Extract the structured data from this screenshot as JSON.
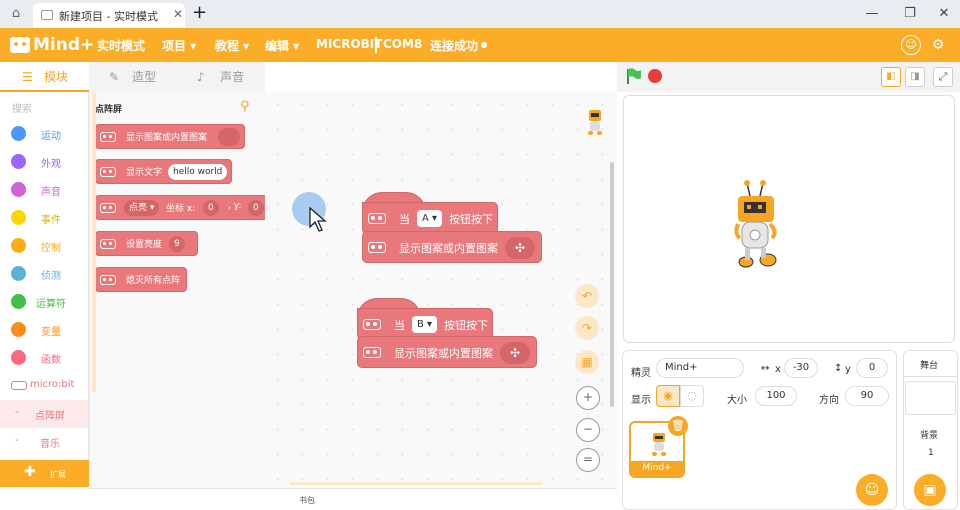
{
  "titlebar": {
    "tab_title": "新建项目 - 实时模式",
    "close": "✕",
    "new_tab": "+",
    "minimize": "—",
    "restore": "❐",
    "close_window": "✕"
  },
  "menubar": {
    "logo_text": "Mind+",
    "items": [
      "实时模式",
      "项目 ▾",
      "教程 ▾",
      "编辑 ▾",
      "MICROBIT",
      "COM8",
      "连接成功"
    ],
    "accent_color": "#fbad28"
  },
  "category_tabs": [
    "模块",
    "造型",
    "声音"
  ],
  "sidebar": {
    "search_placeholder": "搜索",
    "categories": [
      {
        "label": "运动",
        "color": "#4c97ff"
      },
      {
        "label": "外观",
        "color": "#9966ff"
      },
      {
        "label": "声音",
        "color": "#cf63cf"
      },
      {
        "label": "事件",
        "color": "#ffd500"
      },
      {
        "label": "控制",
        "color": "#ffab19"
      },
      {
        "label": "侦测",
        "color": "#5cb1d6"
      },
      {
        "label": "运算符",
        "color": "#40bf4a"
      },
      {
        "label": "变量",
        "color": "#ff8c1a"
      },
      {
        "label": "函数",
        "color": "#ff6680"
      },
      {
        "label": "micro:bit",
        "color": "#e8787b"
      },
      {
        "label": "点阵屏",
        "color": "#e8787b"
      },
      {
        "label": "音乐",
        "color": "#e8787b"
      }
    ],
    "extension_label": "扩展"
  },
  "flyout": {
    "title": "点阵屏",
    "blocks": [
      {
        "text": "显示图案或内置图案"
      },
      {
        "text": "显示文字",
        "field": "hello world"
      },
      {
        "text": "点亮",
        "drop": "▾",
        "coord_label": "坐标 x:",
        "x": "0",
        "y_label": ", y:",
        "y": "0"
      },
      {
        "text": "设置亮度",
        "value": "9"
      },
      {
        "text": "熄灭所有点阵"
      }
    ]
  },
  "workspace": {
    "scripts": [
      {
        "hat_text": "当",
        "button": "A",
        "hat_suffix": "按钮按下",
        "body": "显示图案或内置图案"
      },
      {
        "hat_text": "当",
        "button": "B",
        "hat_suffix": "按钮按下",
        "body": "显示图案或内置图案"
      }
    ],
    "zoom_in": "+",
    "zoom_out": "−",
    "zoom_reset": "="
  },
  "bottombar": {
    "backpack": "书包"
  },
  "sprite": {
    "label": "精灵",
    "name": "Mind+",
    "x_label": "x",
    "x": "-30",
    "y_label": "y",
    "y": "0",
    "show_label": "显示",
    "size_label": "大小",
    "size": "100",
    "direction_label": "方向",
    "direction": "90",
    "card_name": "Mind+"
  },
  "stage_panel": {
    "title": "舞台",
    "backdrop_label": "背景",
    "backdrop_count": "1"
  }
}
